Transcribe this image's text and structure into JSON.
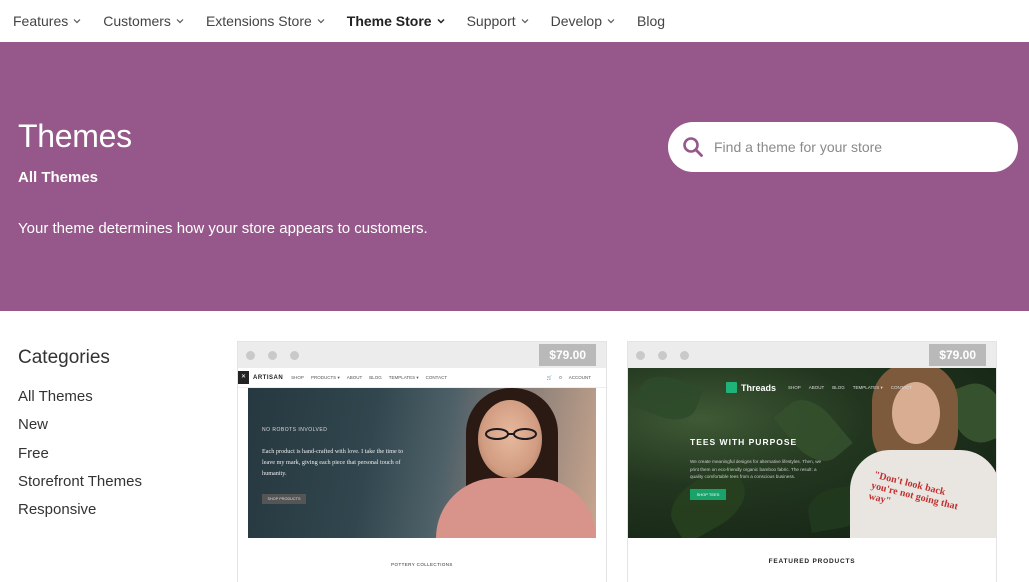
{
  "nav": {
    "items": [
      {
        "label": "Features",
        "dropdown": true,
        "active": false
      },
      {
        "label": "Customers",
        "dropdown": true,
        "active": false
      },
      {
        "label": "Extensions Store",
        "dropdown": true,
        "active": false
      },
      {
        "label": "Theme Store",
        "dropdown": true,
        "active": true
      },
      {
        "label": "Support",
        "dropdown": true,
        "active": false
      },
      {
        "label": "Develop",
        "dropdown": true,
        "active": false
      },
      {
        "label": "Blog",
        "dropdown": false,
        "active": false
      }
    ]
  },
  "hero": {
    "title": "Themes",
    "subtitle": "All Themes",
    "description": "Your theme determines how your store appears to customers.",
    "background": "#96588a",
    "search_placeholder": "Find a theme for your store",
    "search_icon": "search-icon"
  },
  "sidebar": {
    "title": "Categories",
    "items": [
      "All Themes",
      "New",
      "Free",
      "Storefront Themes",
      "Responsive"
    ]
  },
  "cards": [
    {
      "price": "$79.00",
      "preview": {
        "brand": "ARTISAN",
        "nav_links": [
          "SHOP",
          "PRODUCTS ▾",
          "ABOUT",
          "BLOG",
          "TEMPLATES ▾",
          "CONTACT"
        ],
        "nav_right": [
          "0",
          "ACCOUNT"
        ],
        "eyebrow": "NO ROBOTS INVOLVED",
        "tagline": "Each product is hand-crafted with love. I take the time to leave my mark, giving each piece that personal touch of humanity.",
        "button": "SHOP PRODUCTS",
        "footer": "POTTERY COLLECTIONS"
      }
    },
    {
      "price": "$79.00",
      "preview": {
        "brand": "Threads",
        "nav_links": [
          "SHOP",
          "ABOUT",
          "BLOG",
          "TEMPLATES ▾",
          "CONTACT"
        ],
        "headline": "TEES WITH PURPOSE",
        "body": "We create meaningful designs for alternative lifestyles. Then, we print them on eco-friendly organic bamboo fabric. The result: a quality comfortable tees from a conscious business.",
        "button": "SHOP TEES",
        "shirt_text": "\"Don't look back you're not going that way\"",
        "footer": "FEATURED PRODUCTS"
      }
    }
  ]
}
